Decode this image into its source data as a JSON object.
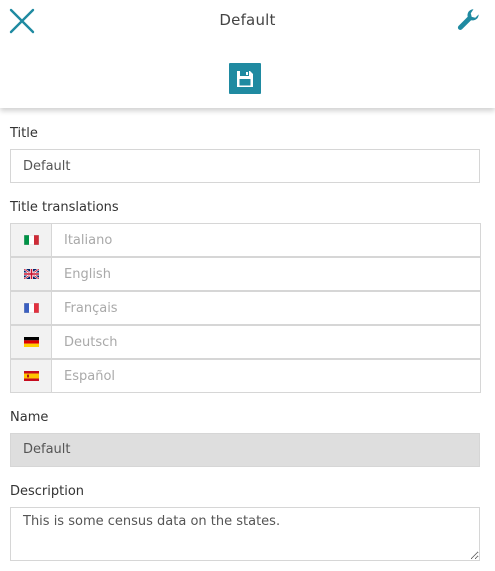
{
  "header": {
    "title": "Default",
    "close_icon": "close-icon",
    "tools_icon": "wrench-icon",
    "save_icon": "floppy-disk-icon",
    "accent_color": "#1f8aa1"
  },
  "form": {
    "title_label": "Title",
    "title_value": "Default",
    "translations_label": "Title translations",
    "translations": [
      {
        "flag": "flag-it-icon",
        "placeholder": "Italiano",
        "value": ""
      },
      {
        "flag": "flag-gb-icon",
        "placeholder": "English",
        "value": ""
      },
      {
        "flag": "flag-fr-icon",
        "placeholder": "Français",
        "value": ""
      },
      {
        "flag": "flag-de-icon",
        "placeholder": "Deutsch",
        "value": ""
      },
      {
        "flag": "flag-es-icon",
        "placeholder": "Español",
        "value": ""
      }
    ],
    "name_label": "Name",
    "name_value": "Default",
    "description_label": "Description",
    "description_value": "This is some census data on the states."
  }
}
